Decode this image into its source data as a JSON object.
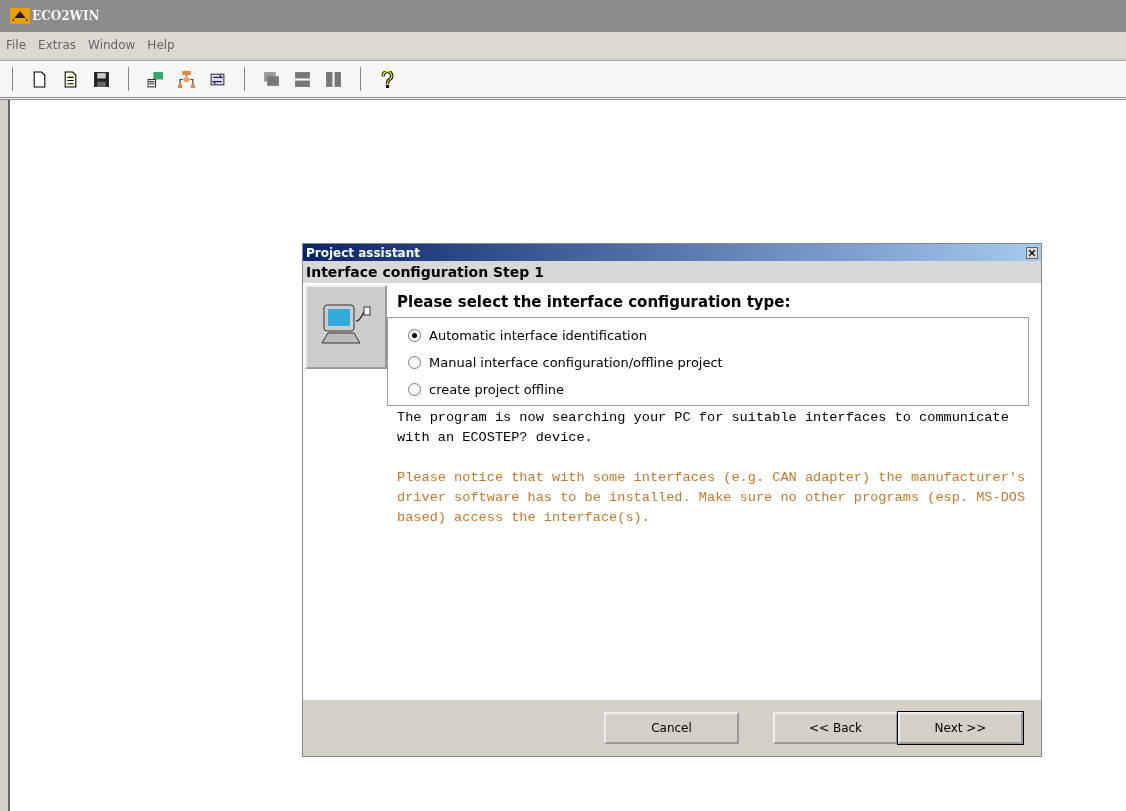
{
  "window": {
    "title": "ECO2WIN"
  },
  "menu": [
    "File",
    "Extras",
    "Window",
    "Help"
  ],
  "toolbar_groups": [
    [
      {
        "kind": "new-file"
      },
      {
        "kind": "open-file"
      },
      {
        "kind": "save"
      }
    ],
    [
      {
        "kind": "network"
      },
      {
        "kind": "flowchart"
      },
      {
        "kind": "transfer"
      }
    ],
    [
      {
        "kind": "cascade"
      },
      {
        "kind": "tile-horizontal"
      },
      {
        "kind": "tile-vertical"
      }
    ],
    [
      {
        "kind": "help"
      }
    ]
  ],
  "dialog": {
    "title": "Project assistant",
    "subtitle": "Interface configuration Step 1",
    "heading": "Please select the interface configuration type:",
    "options": [
      {
        "label": "Automatic interface identification",
        "selected": true
      },
      {
        "label": "Manual interface configuration/offline project",
        "selected": false
      },
      {
        "label": "create project offline",
        "selected": false
      }
    ],
    "info": "The program is now searching your PC for suitable interfaces to communicate with an ECOSTEP? device.",
    "notice": "Please notice that with some interfaces (e.g. CAN adapter) the manufacturer's driver software has to be installed. Make sure no other programs (esp. MS-DOS based) access the interface(s).",
    "buttons": [
      {
        "label": "Cancel",
        "default": false
      },
      {
        "label": "<< Back",
        "default": false
      },
      {
        "label": "Next >>",
        "default": true
      }
    ]
  }
}
